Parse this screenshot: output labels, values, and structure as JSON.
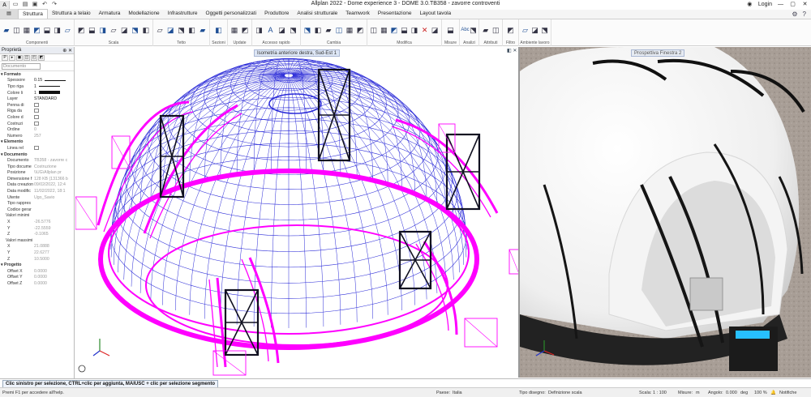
{
  "window": {
    "title": "Allplan 2022 - Dome experience 3 - DOME 3.0.TB358 - zavorre controventi",
    "login": "Login"
  },
  "tabs": [
    "Struttura",
    "Struttura a telaio",
    "Armatura",
    "Modellazione",
    "Infrastrutture",
    "Oggetti personalizzati",
    "Produttore",
    "Analisi strutturale",
    "Teamwork",
    "Presentazione",
    "Layout tavola"
  ],
  "active_tab": "Struttura",
  "ribbon_groups": [
    "Componenti",
    "Scala",
    "Tetto",
    "Sezioni",
    "Update",
    "Accesso rapido",
    "Cambia",
    "Modifica",
    "Misure",
    "Analizi",
    "Attributi",
    "Filtro",
    "Ambiente lavoro"
  ],
  "panel": {
    "title": "Proprietà",
    "filter": "Documento",
    "rows": [
      {
        "t": "sec",
        "label": "Formato"
      },
      {
        "label": "Spessore",
        "value": "0.15",
        "kind": "line"
      },
      {
        "label": "Tipo riga",
        "value": "1",
        "kind": "line"
      },
      {
        "label": "Colore li",
        "value": "1",
        "kind": "swatch"
      },
      {
        "label": "Layer",
        "value": "STANDARD",
        "kind": "dark"
      },
      {
        "label": "Penna di",
        "value": "",
        "kind": "chk"
      },
      {
        "label": "Riga da",
        "value": "",
        "kind": "chk"
      },
      {
        "label": "Colore d",
        "value": "",
        "kind": "chk"
      },
      {
        "label": "Costruzi",
        "value": "",
        "kind": "chk"
      },
      {
        "label": "Ordine",
        "value": "0"
      },
      {
        "label": "Numero",
        "value": "257"
      },
      {
        "t": "sec",
        "label": "Elemento"
      },
      {
        "label": "Linea rel",
        "value": "",
        "kind": "chk"
      },
      {
        "t": "sec",
        "label": "Documento"
      },
      {
        "label": "Documento",
        "value": "TB358 - zavorre c"
      },
      {
        "label": "Tipo docume",
        "value": "Costruzione"
      },
      {
        "label": "Posizione",
        "value": "\\\\UG\\Allplan pr"
      },
      {
        "label": "Dimensione f",
        "value": "128 KB (131366 b"
      },
      {
        "label": "Data creazion",
        "value": "09/02/2022, 12:4"
      },
      {
        "label": "Data modific",
        "value": "11/02/2022, 18:1"
      },
      {
        "label": "Utente",
        "value": "Ugo_Savio"
      },
      {
        "label": "Tipo rappres",
        "value": ""
      },
      {
        "label": "Codice gerar",
        "value": ""
      },
      {
        "t": "sub",
        "label": "Valori minimi"
      },
      {
        "label": "X",
        "value": "-26.5776"
      },
      {
        "label": "Y",
        "value": "-22.5559"
      },
      {
        "label": "Z",
        "value": "-0.1065"
      },
      {
        "t": "sub",
        "label": "Valori massimi"
      },
      {
        "label": "X",
        "value": "21.0888"
      },
      {
        "label": "Y",
        "value": "22.6277"
      },
      {
        "label": "Z",
        "value": "10.5000"
      },
      {
        "t": "sec",
        "label": "Progetto"
      },
      {
        "label": "Offset X",
        "value": "0.0000"
      },
      {
        "label": "Offset Y",
        "value": "0.0000"
      },
      {
        "label": "Offset Z",
        "value": "0.0000"
      }
    ]
  },
  "viewport1": {
    "label": "Isometria anteriore destra, Sud-Est 1"
  },
  "viewport2": {
    "label": "Prospettiva Finestra 2"
  },
  "command_bar": "Clic sinistro per selezione, CTRL+clic per aggiunta, MAIUSC + clic per selezione segmento",
  "status": {
    "help": "Premi F1 per accedere all'help.",
    "paese_label": "Paese:",
    "paese": "Italia",
    "tipo_label": "Tipo disegno:",
    "tipo": "Definizione scala",
    "scala_label": "Scala:",
    "scala": "1 : 100",
    "misure_label": "Misure:",
    "misure": "m",
    "angolo_label": "Angolo:",
    "angolo": "0.000",
    "deg": "deg",
    "percent": "100 %",
    "notifiche": "Notifiche"
  },
  "colors": {
    "dome_wire": "#2b2bd8",
    "magenta": "#ff00ff",
    "frame": "#101020",
    "accent_tab": "#1f4f95"
  }
}
